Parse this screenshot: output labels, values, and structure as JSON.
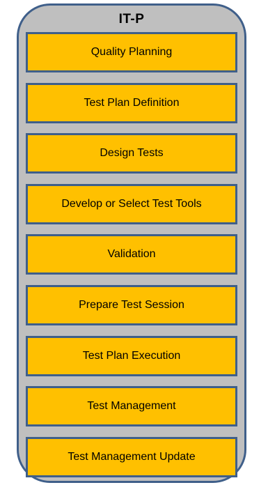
{
  "panel": {
    "title": "IT-P",
    "border_color": "#3f5f8a",
    "fill_color": "#bfbfbf"
  },
  "steps": [
    {
      "label": "Quality Planning"
    },
    {
      "label": "Test Plan Definition"
    },
    {
      "label": "Design Tests"
    },
    {
      "label": "Develop or Select Test Tools"
    },
    {
      "label": "Validation"
    },
    {
      "label": "Prepare Test Session"
    },
    {
      "label": "Test Plan Execution"
    },
    {
      "label": "Test Management"
    },
    {
      "label": "Test Management Update"
    }
  ],
  "step_fill_color": "#ffc000"
}
